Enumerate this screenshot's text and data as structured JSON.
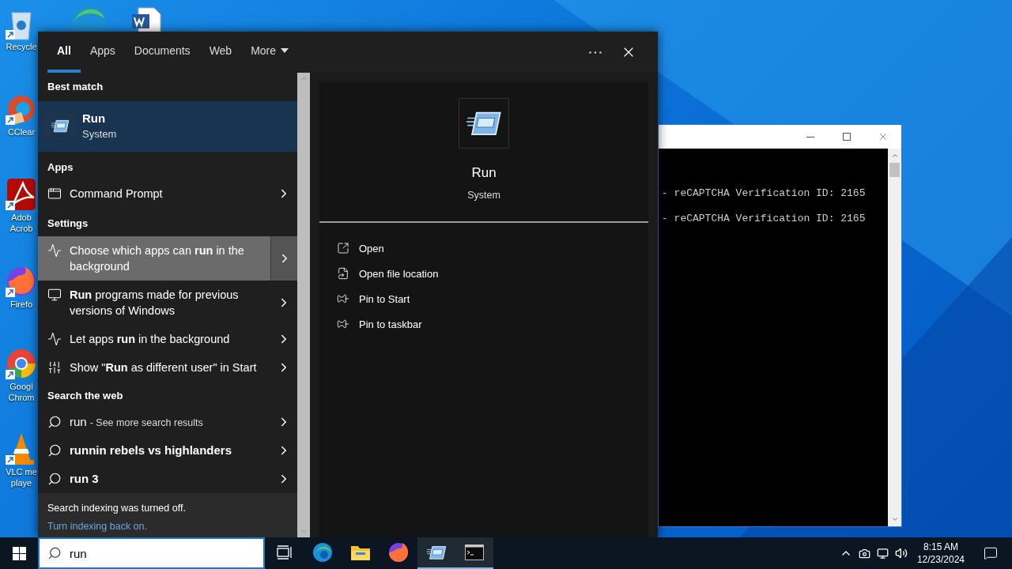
{
  "desktop_icons": [
    {
      "kind": "recycle",
      "lines": [
        "Recycle"
      ]
    },
    {
      "kind": "ccleaner",
      "lines": [
        "CClear"
      ]
    },
    {
      "kind": "acrobat",
      "lines": [
        "Adob",
        "Acrob"
      ]
    },
    {
      "kind": "firefox",
      "lines": [
        "Firefo"
      ]
    },
    {
      "kind": "chrome",
      "lines": [
        "Googl",
        "Chrom"
      ]
    },
    {
      "kind": "vlc",
      "lines": [
        "VLC me",
        "playe"
      ]
    }
  ],
  "console_window": {
    "lines": [
      "- reCAPTCHA Verification ID: 2165",
      "- reCAPTCHA Verification ID: 2165"
    ]
  },
  "search_panel": {
    "tabs": [
      {
        "label": "All",
        "selected": true,
        "dropdown": false
      },
      {
        "label": "Apps",
        "selected": false,
        "dropdown": false
      },
      {
        "label": "Documents",
        "selected": false,
        "dropdown": false
      },
      {
        "label": "Web",
        "selected": false,
        "dropdown": false
      },
      {
        "label": "More",
        "selected": false,
        "dropdown": true
      }
    ],
    "best_match": {
      "heading": "Best match",
      "title": "Run",
      "subtitle": "System",
      "selected": true
    },
    "groups": [
      {
        "heading": "Apps",
        "items": [
          {
            "kind": "console",
            "text": "Command Prompt",
            "highlighted": false
          }
        ]
      },
      {
        "heading": "Settings",
        "items": [
          {
            "kind": "activity",
            "text": "Choose which apps can **run** in the background",
            "highlighted": true
          },
          {
            "kind": "compat",
            "text": "**Run** programs made for previous versions of Windows",
            "highlighted": false
          },
          {
            "kind": "activity",
            "text": "Let apps **run** in the background",
            "highlighted": false
          },
          {
            "kind": "tools",
            "text": "Show \"**Run** as different user\" in Start",
            "highlighted": false
          }
        ]
      }
    ],
    "web": {
      "heading": "Search the web",
      "items": [
        {
          "query": "run",
          "hint": "- See more search results",
          "bold": false
        },
        {
          "query": "runnin rebels vs highlanders",
          "bold": true
        },
        {
          "query": "run 3",
          "bold": true
        }
      ]
    },
    "footer": {
      "message": "Search indexing was turned off.",
      "link": "Turn indexing back on."
    },
    "preview": {
      "title": "Run",
      "subtitle": "System",
      "actions": [
        {
          "kind": "open",
          "label": "Open"
        },
        {
          "kind": "folder",
          "label": "Open file location"
        },
        {
          "kind": "pin",
          "label": "Pin to Start"
        },
        {
          "kind": "pin",
          "label": "Pin to taskbar"
        }
      ]
    }
  },
  "taskbar": {
    "search_value": "run",
    "apps": [
      {
        "kind": "taskview",
        "running": false
      },
      {
        "kind": "edge",
        "running": false
      },
      {
        "kind": "explorer",
        "running": false
      },
      {
        "kind": "firefox",
        "running": false
      },
      {
        "kind": "run",
        "running": true
      },
      {
        "kind": "console",
        "running": true
      }
    ],
    "time": "8:15 AM",
    "date": "12/23/2024"
  }
}
